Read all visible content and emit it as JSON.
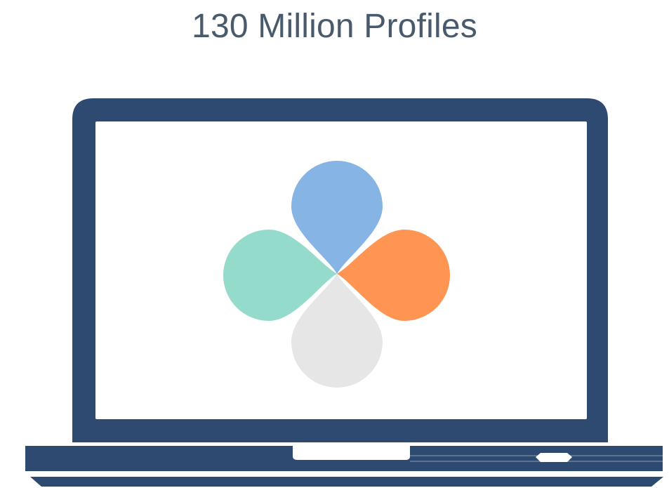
{
  "title": "130 Million Profiles",
  "colors": {
    "title_text": "#485a6c",
    "laptop_frame": "#2e4a70",
    "screen": "#ffffff",
    "petal_top": "#85b4e5",
    "petal_right": "#fe9553",
    "petal_bottom": "#e6e6e6",
    "petal_left": "#95dbcc"
  },
  "illustration": {
    "device": "laptop-icon",
    "logo": "four-petal-logo-icon"
  }
}
